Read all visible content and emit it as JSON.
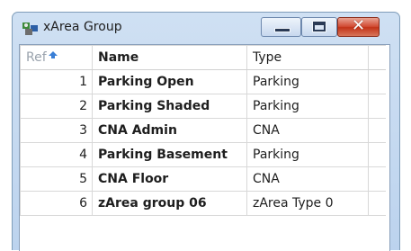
{
  "window": {
    "title": "xArea Group",
    "icons": {
      "app": "area-group-icon",
      "minimize": "minimize-icon",
      "maximize": "maximize-icon",
      "close": "close-icon"
    }
  },
  "table": {
    "headers": {
      "ref": "Ref",
      "name": "Name",
      "type": "Type"
    },
    "sort_icon": "sort-arrow-icon",
    "rows": [
      {
        "ref": "1",
        "name": "Parking Open",
        "type": "Parking"
      },
      {
        "ref": "2",
        "name": "Parking Shaded",
        "type": "Parking"
      },
      {
        "ref": "3",
        "name": "CNA Admin",
        "type": "CNA"
      },
      {
        "ref": "4",
        "name": "Parking Basement",
        "type": "Parking"
      },
      {
        "ref": "5",
        "name": "CNA Floor",
        "type": "CNA"
      },
      {
        "ref": "6",
        "name": "zArea group 06",
        "type": "zArea Type 0"
      }
    ]
  },
  "colors": {
    "title_bar": "#c6daf1",
    "close_button": "#c23217",
    "grid_line": "#d8d8d8"
  }
}
